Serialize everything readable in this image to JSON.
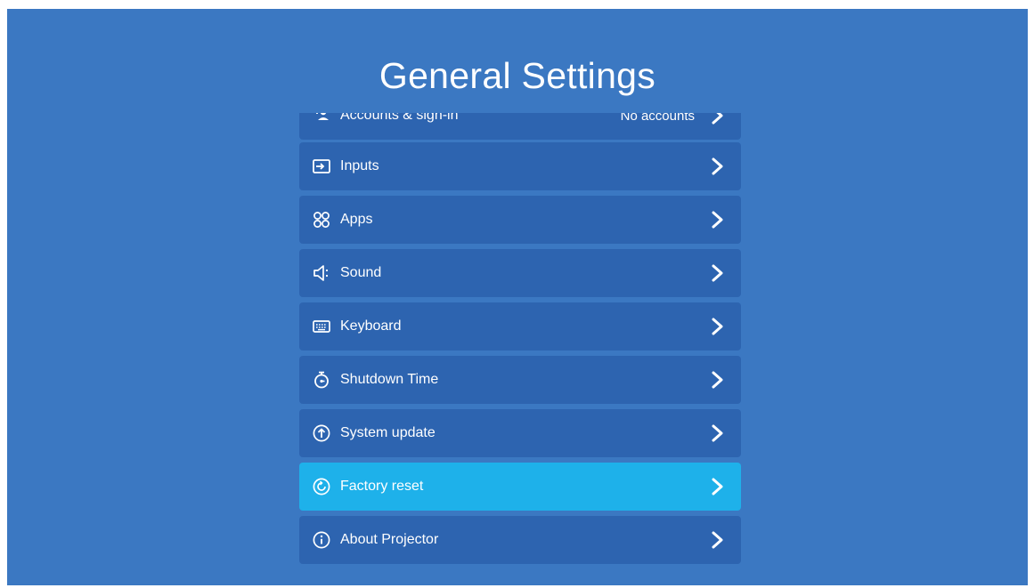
{
  "header": {
    "title": "General Settings"
  },
  "menu": {
    "items": [
      {
        "label": "Accounts & sign-in",
        "value": "No accounts",
        "icon": "accounts-icon"
      },
      {
        "label": "Inputs",
        "icon": "input-icon"
      },
      {
        "label": "Apps",
        "icon": "apps-icon"
      },
      {
        "label": "Sound",
        "icon": "sound-icon"
      },
      {
        "label": "Keyboard",
        "icon": "keyboard-icon"
      },
      {
        "label": "Shutdown Time",
        "icon": "timer-icon"
      },
      {
        "label": "System update",
        "icon": "update-icon"
      },
      {
        "label": "Factory reset",
        "icon": "reset-icon",
        "selected": true
      },
      {
        "label": "About Projector",
        "icon": "info-icon"
      }
    ]
  },
  "colors": {
    "background": "#3b78c2",
    "row": "#2d64b0",
    "selected_row": "#1eb1ea",
    "text": "#ffffff"
  }
}
